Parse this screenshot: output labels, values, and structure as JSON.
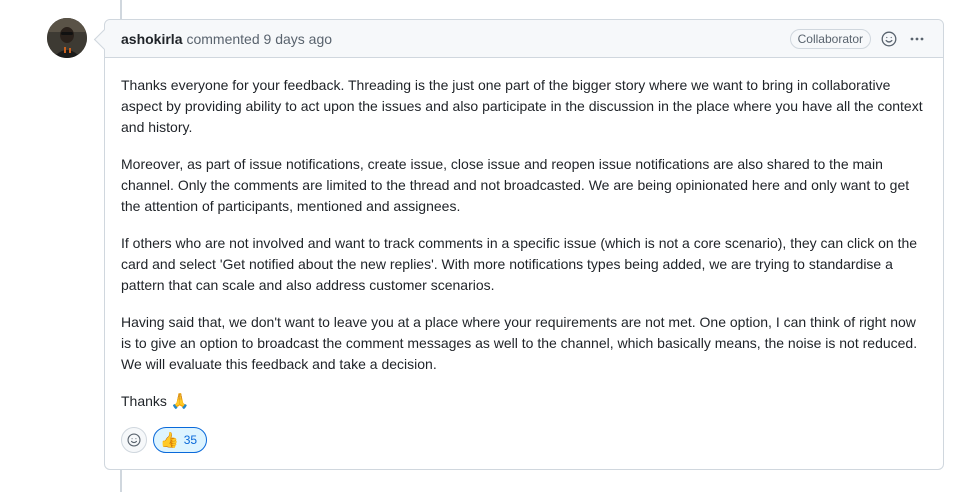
{
  "comment": {
    "author": "ashokirla",
    "meta": "commented 9 days ago",
    "badge": "Collaborator",
    "paragraphs": [
      "Thanks everyone for your feedback. Threading is the just one part of the bigger story where we want to bring in collaborative aspect by providing ability to act upon the issues and also participate in the discussion in the place where you have all the context and history.",
      "Moreover, as part of issue notifications, create issue, close issue and reopen issue notifications are also shared to the main channel. Only the comments are limited to the thread and not broadcasted. We are being opinionated here and only want to get the attention of participants, mentioned and assignees.",
      "If others who are not involved and want to track comments in a specific issue (which is not a core scenario), they can click on the card and select 'Get notified about the new replies'. With more notifications types being added, we are trying to standardise a pattern that can scale and also address customer scenarios.",
      "Having said that, we don't want to leave you at a place where your requirements are not met. One option, I can think of right now is to give an option to broadcast the comment messages as well to the channel, which basically means, the noise is not reduced. We will evaluate this feedback and take a decision."
    ],
    "thanks_text": "Thanks",
    "thanks_emoji": "🙏",
    "reactions": [
      {
        "emoji": "👍",
        "count": "35"
      }
    ]
  },
  "icons": {
    "header_emoji": "smiley-icon",
    "header_menu": "kebab-horizontal-icon",
    "add_reaction": "smiley-icon"
  },
  "colors": {
    "border": "#d0d7de",
    "header_bg": "#f6f8fa",
    "accent": "#0969da",
    "reaction_bg": "#ddf4ff"
  }
}
